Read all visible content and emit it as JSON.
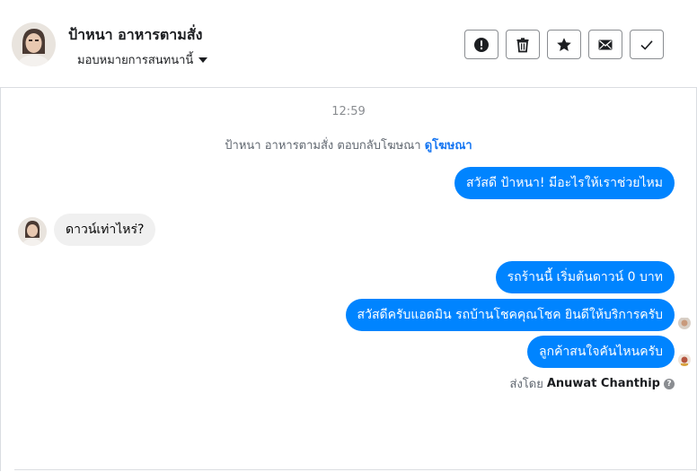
{
  "header": {
    "contact_name": "ป้าหนา อาหารตามสั่ง",
    "assign_label": "มอบหมายการสนทนานี้",
    "actions": [
      "alert-icon",
      "trash-icon",
      "star-icon",
      "envelope-icon",
      "check-icon"
    ]
  },
  "thread": {
    "timestamp": "12:59",
    "ad_notice_text": "ป้าหนา อาหารตามสั่ง ตอบกลับโฆษณา",
    "ad_notice_link": "ดูโฆษณา",
    "messages": [
      {
        "direction": "outgoing",
        "text": "สวัสดี ป้าหนา! มีอะไรให้เราช่วยไหม"
      },
      {
        "direction": "incoming",
        "text": "ดาวน์เท่าไหร่?"
      },
      {
        "direction": "outgoing",
        "text": "รถร้านนี้ เริ่มต้นดาวน์ 0 บาท"
      },
      {
        "direction": "outgoing",
        "text": "สวัสดีครับแอดมิน รถบ้านโชคคุณโชค ยินดีให้บริการครับ"
      },
      {
        "direction": "outgoing",
        "text": "ลูกค้าสนใจคันไหนครับ"
      }
    ],
    "sent_by_prefix": "ส่งโดย",
    "sent_by_name": "Anuwat Chanthip"
  },
  "colors": {
    "accent": "#0084ff",
    "link": "#1877f2",
    "incoming_bubble": "#f0f0f0"
  }
}
